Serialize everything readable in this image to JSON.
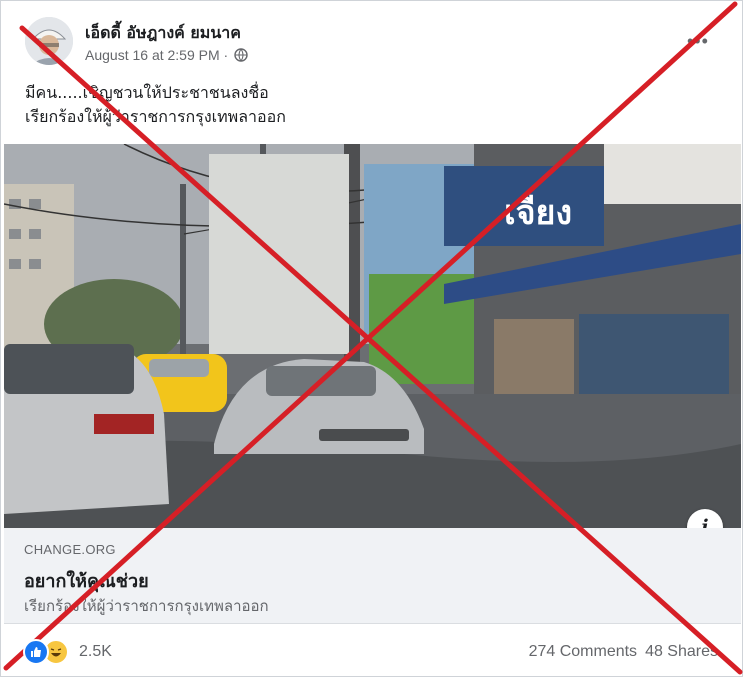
{
  "post": {
    "author": "เอ็ดดี้ อัษฎางค์ ยมนาค",
    "timestamp": "August 16 at 2:59 PM ·",
    "privacy_icon": "globe-icon",
    "more_icon": "more-options-icon",
    "text_lines": [
      "มีคน.....เชิญชวนให้ประชาชนลงชื่อ",
      "เรียกร้องให้ผู้ว่าราชการกรุงเทพลาออก"
    ]
  },
  "link_preview": {
    "domain": "CHANGE.ORG",
    "title": "อยากให้คุณช่วย",
    "subtitle": "เรียกร้องให้ผู้ว่าราชการกรุงเทพลาออก",
    "info_label": "i",
    "shop_sign": "เจียง"
  },
  "footer": {
    "reaction_icons": [
      "like-icon",
      "haha-icon"
    ],
    "reaction_count": "2.5K",
    "comments": "274 Comments",
    "shares": "48 Shares"
  },
  "colors": {
    "cross": "#d61f26",
    "link_box_bg": "#f0f2f5",
    "secondary_text": "#65676b",
    "like_blue": "#1877f2"
  }
}
